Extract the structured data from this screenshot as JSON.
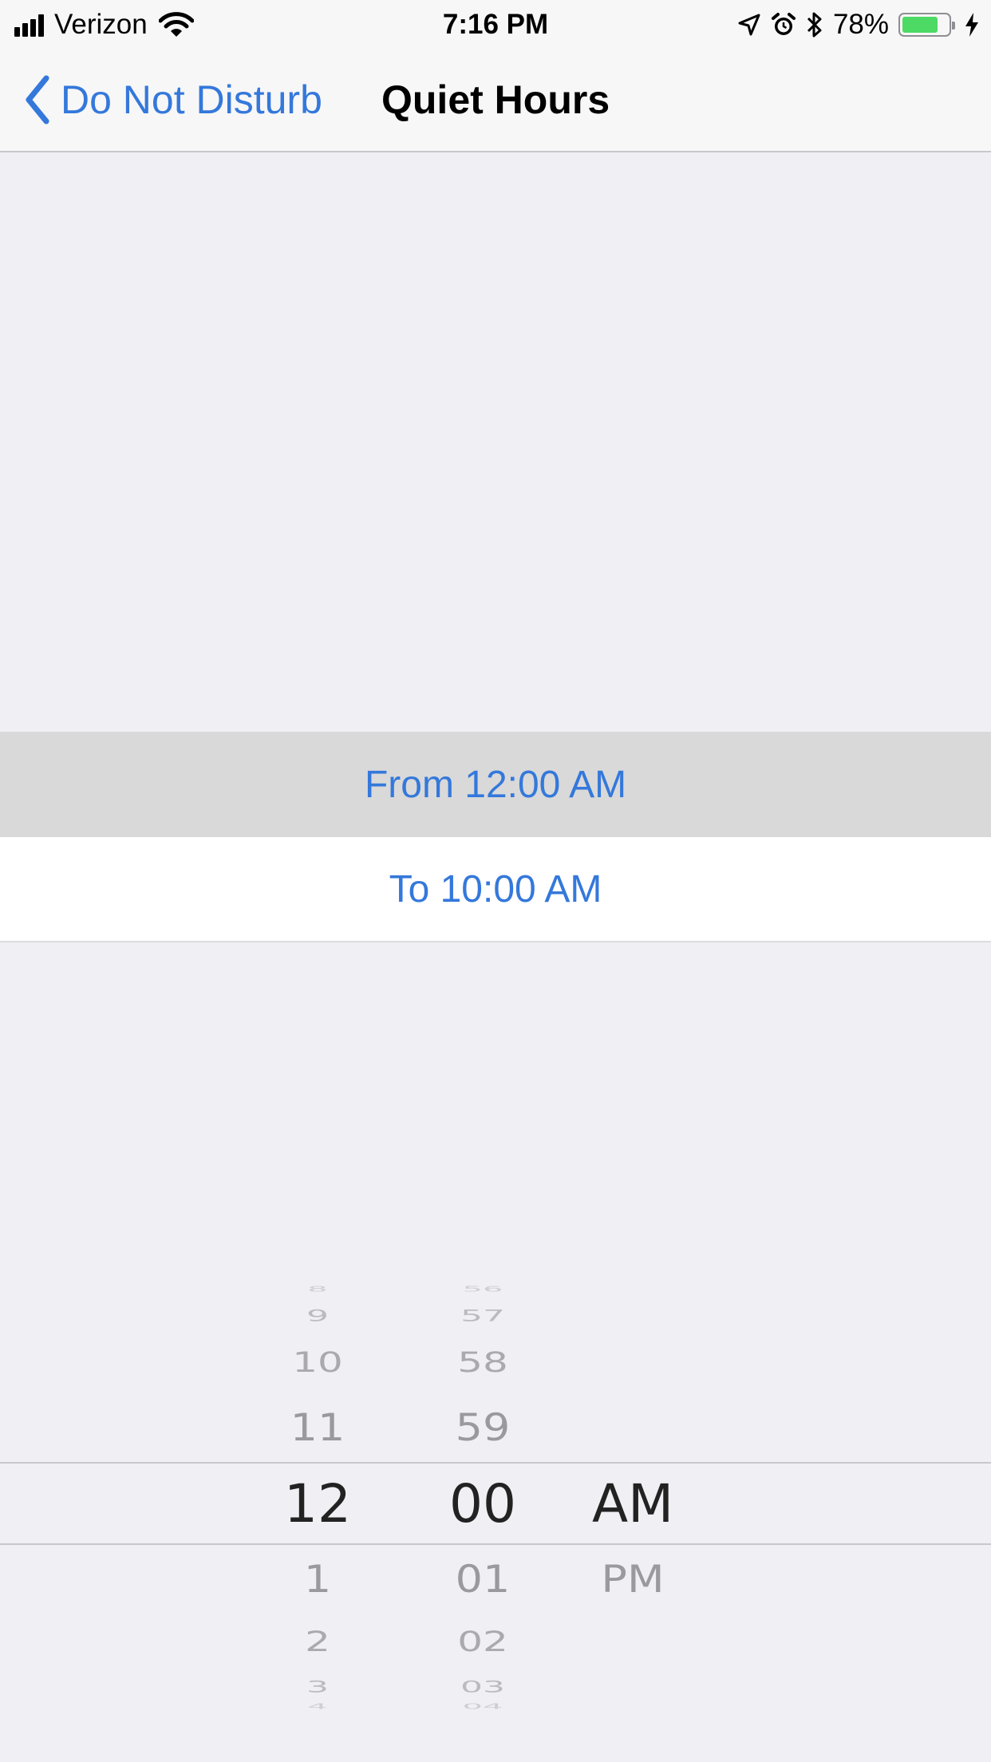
{
  "status_bar": {
    "carrier": "Verizon",
    "time": "7:16 PM",
    "battery_percent": "78%",
    "battery_level": 0.78
  },
  "nav": {
    "back_label": "Do Not Disturb",
    "title": "Quiet Hours"
  },
  "schedule": {
    "from_label": "From 12:00 AM",
    "to_label": "To 10:00 AM"
  },
  "picker": {
    "hours": {
      "above": [
        "8",
        "9",
        "10",
        "11"
      ],
      "selected": "12",
      "below": [
        "1",
        "2",
        "3",
        "4"
      ]
    },
    "minutes": {
      "above": [
        "56",
        "57",
        "58",
        "59"
      ],
      "selected": "00",
      "below": [
        "01",
        "02",
        "03",
        "04"
      ]
    },
    "period": {
      "selected": "AM",
      "below": [
        "PM"
      ]
    }
  },
  "colors": {
    "accent": "#3478db",
    "background": "#efeff4",
    "selected_row": "#d9d9d9",
    "battery": "#4cd964"
  },
  "icons": [
    "signal-icon",
    "wifi-icon",
    "location-icon",
    "alarm-icon",
    "bluetooth-icon",
    "battery-icon",
    "charging-icon",
    "chevron-left-icon"
  ]
}
